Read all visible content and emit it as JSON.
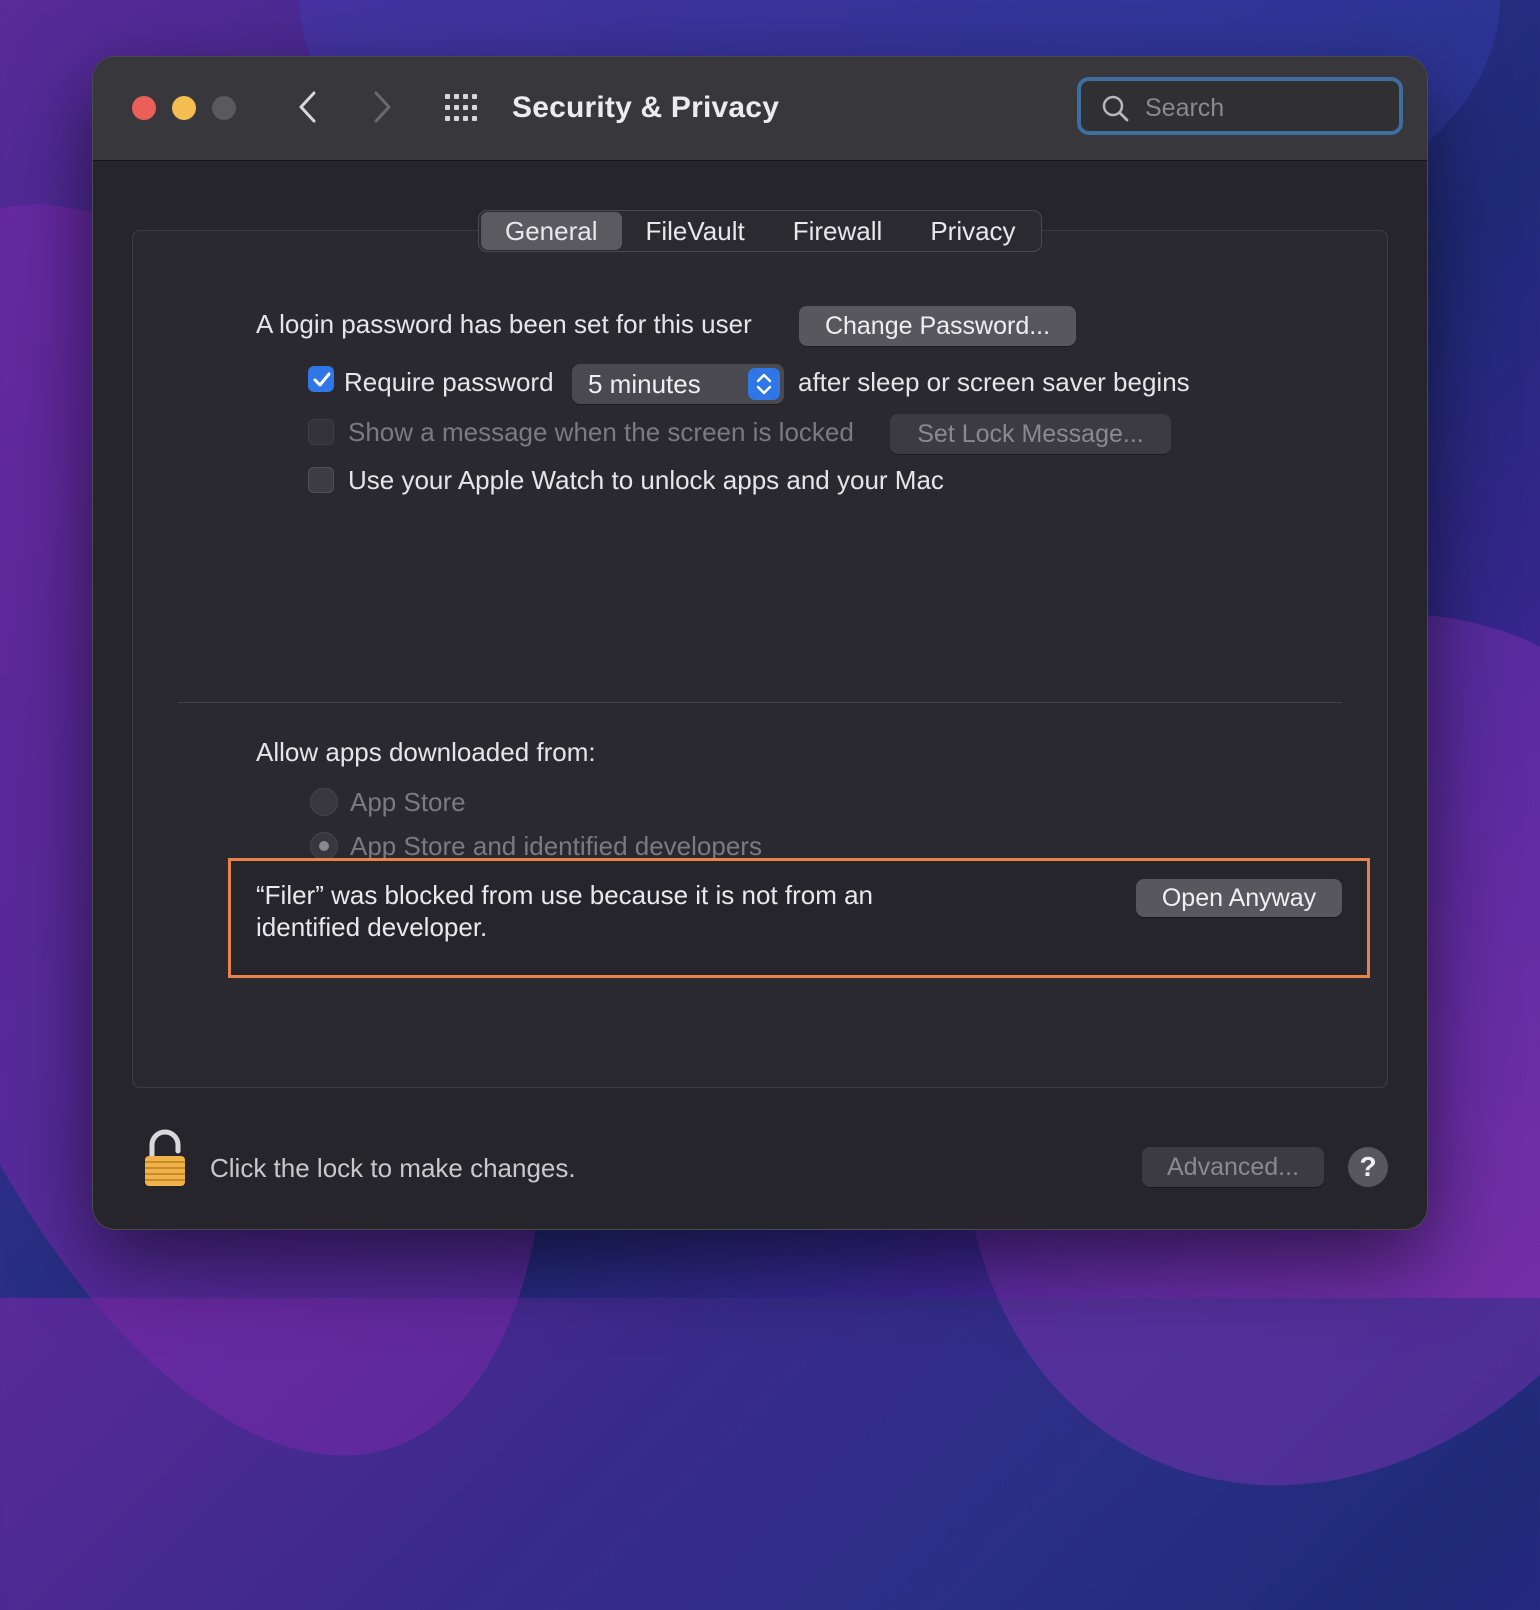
{
  "window": {
    "title": "Security & Privacy",
    "search_placeholder": "Search"
  },
  "tabs": [
    {
      "label": "General",
      "active": true
    },
    {
      "label": "FileVault",
      "active": false
    },
    {
      "label": "Firewall",
      "active": false
    },
    {
      "label": "Privacy",
      "active": false
    }
  ],
  "general": {
    "login_password_text": "A login password has been set for this user",
    "change_password_label": "Change Password...",
    "require_password": {
      "label": "Require password",
      "checked": true
    },
    "require_delay": "5 minutes",
    "after_sleep_text": "after sleep or screen saver begins",
    "show_message": {
      "label": "Show a message when the screen is locked",
      "checked": false,
      "enabled": false
    },
    "set_lock_message_label": "Set Lock Message...",
    "apple_watch": {
      "label": "Use your Apple Watch to unlock apps and your Mac",
      "checked": false
    }
  },
  "downloads": {
    "heading": "Allow apps downloaded from:",
    "options": [
      {
        "label": "App Store",
        "selected": false
      },
      {
        "label": "App Store and identified developers",
        "selected": true
      }
    ]
  },
  "blocked": {
    "message_line1": "“Filer” was blocked from use because it is not from an",
    "message_line2": "identified developer.",
    "open_anyway_label": "Open Anyway",
    "highlight_color": "#e8834a"
  },
  "footer": {
    "lock_text": "Click the lock to make changes.",
    "advanced_label": "Advanced...",
    "help_label": "?"
  },
  "colors": {
    "accent": "#2f76e6",
    "close": "#ec5f58",
    "minimize": "#f4bd4f",
    "zoom": "#5a595e"
  },
  "icons": [
    "chevron-left-icon",
    "chevron-right-icon",
    "grid-icon",
    "search-icon",
    "checkmark-icon",
    "updown-arrows-icon",
    "lock-icon",
    "help-icon"
  ]
}
